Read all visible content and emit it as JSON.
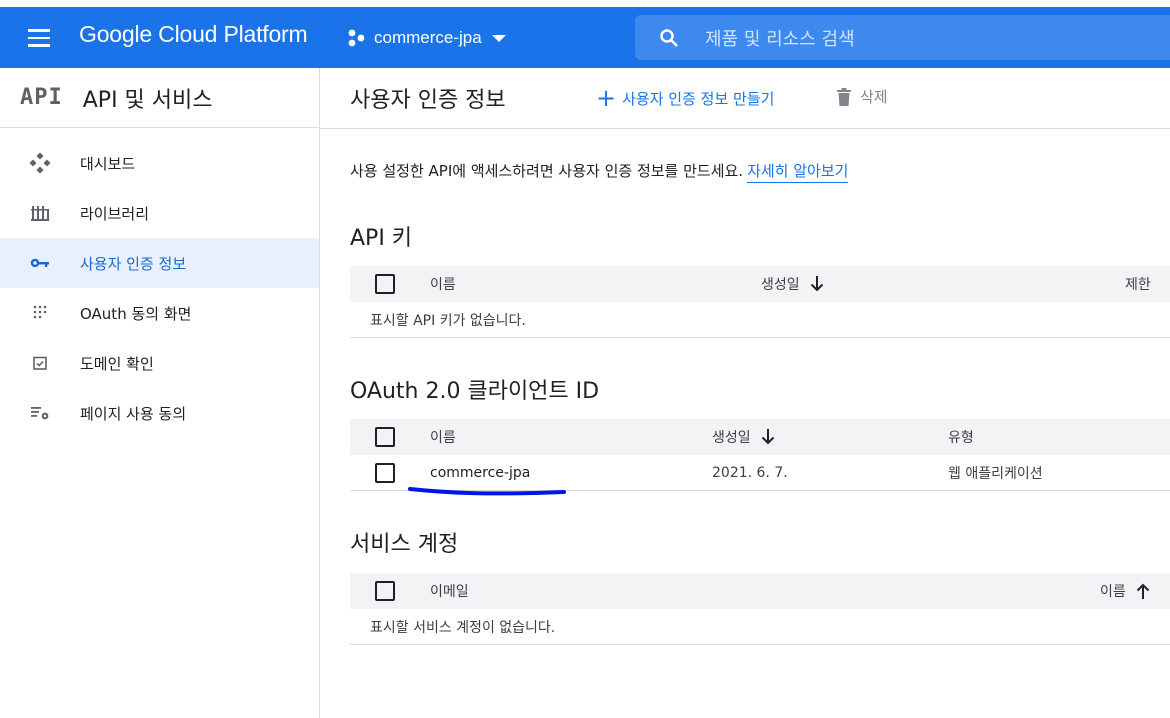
{
  "topbar": {
    "brand": "Google Cloud Platform",
    "project": "commerce-jpa",
    "search_placeholder": "제품 및 리소스 검색",
    "color": "#1a73e8"
  },
  "sidebar": {
    "logo": "API",
    "title": "API 및 서비스",
    "items": [
      {
        "label": "대시보드",
        "icon": "dashboard-icon"
      },
      {
        "label": "라이브러리",
        "icon": "library-icon"
      },
      {
        "label": "사용자 인증 정보",
        "icon": "key-icon",
        "active": true
      },
      {
        "label": "OAuth 동의 화면",
        "icon": "consent-dots-icon"
      },
      {
        "label": "도메인 확인",
        "icon": "domain-check-icon"
      },
      {
        "label": "페이지 사용 동의",
        "icon": "settings-list-icon"
      }
    ]
  },
  "main": {
    "title": "사용자 인증 정보",
    "create_label": "사용자 인증 정보 만들기",
    "delete_label": "삭제",
    "intro_text": "사용 설정한 API에 액세스하려면 사용자 인증 정보를 만드세요.",
    "intro_link": "자세히 알아보기",
    "api_keys": {
      "title": "API 키",
      "columns": [
        "이름",
        "생성일",
        "제한"
      ],
      "empty": "표시할 API 키가 없습니다."
    },
    "oauth": {
      "title": "OAuth 2.0 클라이언트 ID",
      "columns": [
        "이름",
        "생성일",
        "유형"
      ],
      "rows": [
        {
          "name": "commerce-jpa",
          "created": "2021. 6. 7.",
          "type": "웹 애플리케이션"
        }
      ]
    },
    "service_accounts": {
      "title": "서비스 계정",
      "columns": [
        "이메일",
        "이름"
      ],
      "empty": "표시할 서비스 계정이 없습니다."
    }
  }
}
